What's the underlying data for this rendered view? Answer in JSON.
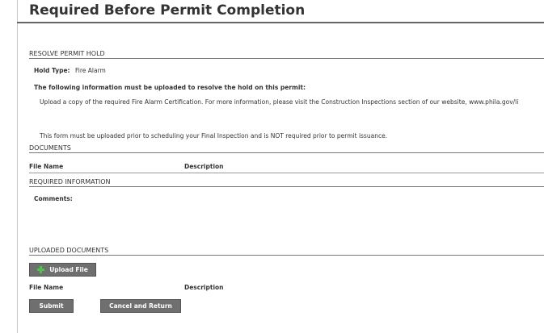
{
  "page": {
    "title": "Required Before Permit Completion"
  },
  "resolve": {
    "section_title": "RESOLVE PERMIT HOLD",
    "hold_type_label": "Hold Type:",
    "hold_type_value": "Fire Alarm",
    "info_heading": "The following information must be uploaded to resolve the hold on this permit:",
    "info_text": "Upload a copy of the required Fire Alarm Certification. For more information, please visit the Construction Inspections section of our website, www.phila.gov/li",
    "note_text": "This form must be uploaded prior to scheduling your Final Inspection and is NOT required prior to permit issuance."
  },
  "documents": {
    "section_title": "DOCUMENTS",
    "col_file_name": "File Name",
    "col_description": "Description"
  },
  "required_info": {
    "section_title": "REQUIRED INFORMATION",
    "comments_label": "Comments:"
  },
  "uploaded": {
    "section_title": "UPLOADED DOCUMENTS",
    "upload_button": "Upload File",
    "col_file_name": "File Name",
    "col_description": "Description"
  },
  "actions": {
    "submit": "Submit",
    "cancel": "Cancel and Return"
  }
}
